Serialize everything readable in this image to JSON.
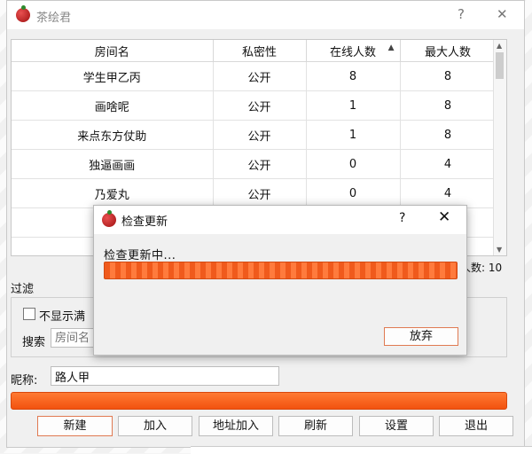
{
  "window": {
    "title": "茶绘君",
    "help_glyph": "?",
    "close_glyph": "✕"
  },
  "table": {
    "columns": [
      "房间名",
      "私密性",
      "在线人数",
      "最大人数"
    ],
    "sort_indicator": "▲",
    "rows": [
      [
        "学生甲乙丙",
        "公开",
        "8",
        "8"
      ],
      [
        "画啥呢",
        "公开",
        "1",
        "8"
      ],
      [
        "来点东方仗助",
        "公开",
        "1",
        "8"
      ],
      [
        "独逼画画",
        "公开",
        "0",
        "4"
      ],
      [
        "乃爱丸",
        "公开",
        "0",
        "4"
      ]
    ]
  },
  "max_people_label": "人数: 10",
  "filter": {
    "title": "过滤",
    "hide_full_label": "不显示满",
    "search_label": "搜索",
    "search_placeholder": "房间名"
  },
  "nickname": {
    "label": "昵称:",
    "value": "路人甲"
  },
  "buttons": {
    "new": "新建",
    "join": "加入",
    "join_by_address": "地址加入",
    "refresh": "刷新",
    "settings": "设置",
    "exit": "退出"
  },
  "dialog": {
    "title": "检查更新",
    "help_glyph": "?",
    "close_glyph": "✕",
    "status": "检查更新中...",
    "abort_button": "放弃"
  },
  "colors": {
    "accent": "#f2520f",
    "accent_border": "#e07a52"
  }
}
